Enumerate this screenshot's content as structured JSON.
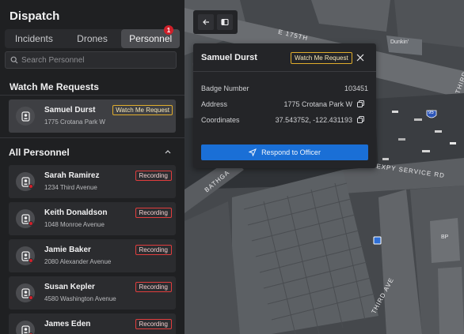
{
  "app": {
    "title": "Dispatch"
  },
  "tabs": [
    {
      "label": "Incidents",
      "active": false
    },
    {
      "label": "Drones",
      "active": false
    },
    {
      "label": "Personnel",
      "active": true,
      "badge": "1"
    }
  ],
  "search": {
    "placeholder": "Search Personnel"
  },
  "watch_section": {
    "title": "Watch Me Requests",
    "items": [
      {
        "name": "Samuel Durst",
        "address": "1775 Crotana Park W",
        "tag": "Watch Me Request"
      }
    ]
  },
  "all_section": {
    "title": "All Personnel",
    "items": [
      {
        "name": "Sarah Ramirez",
        "address": "1234 Third Avenue",
        "tag": "Recording"
      },
      {
        "name": "Keith Donaldson",
        "address": "1048 Monroe Avenue",
        "tag": "Recording"
      },
      {
        "name": "Jamie Baker",
        "address": "2080 Alexander Avenue",
        "tag": "Recording"
      },
      {
        "name": "Susan Kepler",
        "address": "4580 Washington Avenue",
        "tag": "Recording"
      },
      {
        "name": "James Eden",
        "address": "",
        "tag": "Recording"
      }
    ]
  },
  "detail": {
    "name": "Samuel Durst",
    "tag": "Watch Me Request",
    "rows": [
      {
        "label": "Badge Number",
        "value": "103451"
      },
      {
        "label": "Address",
        "value": "1775 Crotana Park W"
      },
      {
        "label": "Coordinates",
        "value": "37.543752, -122.431193"
      }
    ],
    "action": "Respond to Officer"
  },
  "map": {
    "labels": {
      "e175": "E 175TH",
      "dunkin": "Dunkin'",
      "third": "THIRD",
      "expy": "EXPY SERVICE RD",
      "bathgate": "BATHGA",
      "third_ave": "THIRD AVE",
      "bp": "BP",
      "route": "95"
    }
  },
  "colors": {
    "accent": "#1a6fd6",
    "recording": "#e13d3d",
    "watch": "#e0ad2c",
    "badge": "#d0202a"
  }
}
